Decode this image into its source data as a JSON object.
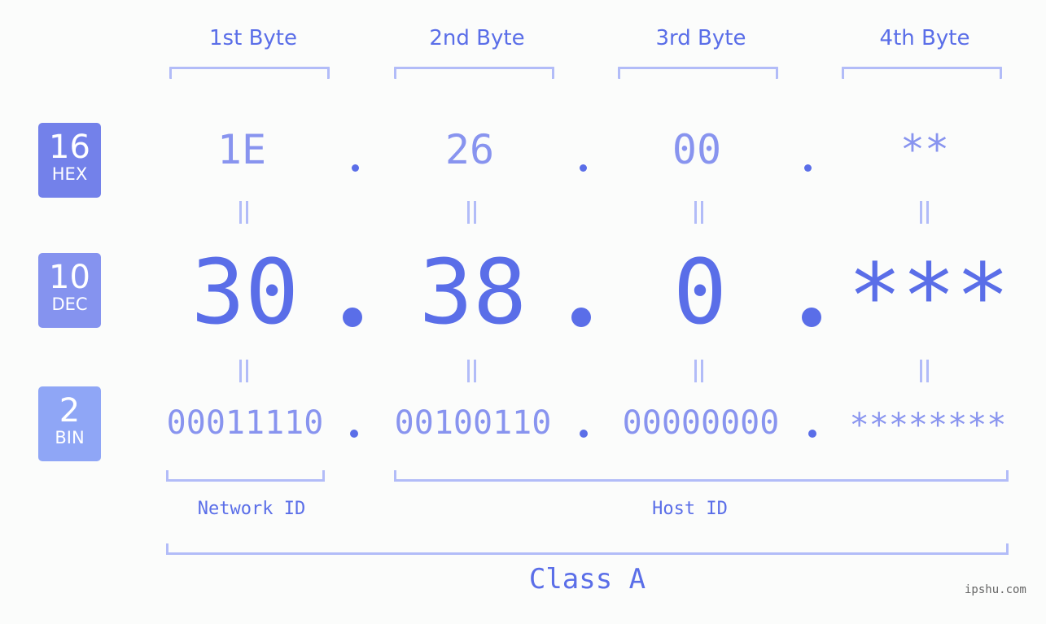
{
  "bytes": [
    {
      "label": "1st Byte",
      "hex": "1E",
      "dec": "30",
      "bin": "00011110"
    },
    {
      "label": "2nd Byte",
      "hex": "26",
      "dec": "38",
      "bin": "00100110"
    },
    {
      "label": "3rd Byte",
      "hex": "00",
      "dec": "0",
      "bin": "00000000"
    },
    {
      "label": "4th Byte",
      "hex": "**",
      "dec": "***",
      "bin": "********"
    }
  ],
  "badges": {
    "hex": {
      "num": "16",
      "label": "HEX",
      "color": "#7381ea"
    },
    "dec": {
      "num": "10",
      "label": "DEC",
      "color": "#8593ef"
    },
    "bin": {
      "num": "2",
      "label": "BIN",
      "color": "#8fa6f6"
    }
  },
  "segments": {
    "network": "Network ID",
    "host": "Host ID"
  },
  "class_label": "Class A",
  "watermark": "ipshu.com",
  "colors": {
    "primary": "#5a6ee8",
    "light": "#8894ef",
    "bracket": "#b2bcf8",
    "background": "#fbfcfb"
  }
}
